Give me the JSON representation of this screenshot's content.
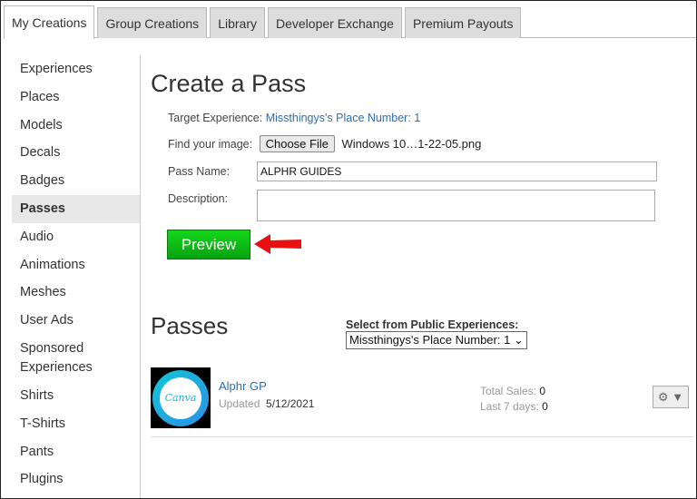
{
  "tabs": [
    "My Creations",
    "Group Creations",
    "Library",
    "Developer Exchange",
    "Premium Payouts"
  ],
  "sidebar": [
    "Experiences",
    "Places",
    "Models",
    "Decals",
    "Badges",
    "Passes",
    "Audio",
    "Animations",
    "Meshes",
    "User Ads",
    "Sponsored Experiences",
    "Shirts",
    "T-Shirts",
    "Pants",
    "Plugins"
  ],
  "create": {
    "title": "Create a Pass",
    "target_label": "Target Experience:",
    "target_value": "Missthingys's Place Number: 1",
    "image_label": "Find your image:",
    "choose_file": "Choose File",
    "file_name": "Windows 10…1-22-05.png",
    "name_label": "Pass Name:",
    "name_value": "ALPHR GUIDES",
    "desc_label": "Description:",
    "desc_value": "",
    "preview": "Preview"
  },
  "passes": {
    "title": "Passes",
    "select_label": "Select from Public Experiences:",
    "select_value": "Missthingys's Place Number: 1",
    "items": [
      {
        "name": "Alphr GP",
        "updated_label": "Updated",
        "updated": "5/12/2021",
        "total_label": "Total Sales:",
        "total": "0",
        "last7_label": "Last 7 days:",
        "last7": "0",
        "thumb_text": "Canva"
      }
    ]
  },
  "colors": {
    "accent": "#2a6fb5",
    "preview": "#0cc315",
    "arrow": "#e81010"
  }
}
